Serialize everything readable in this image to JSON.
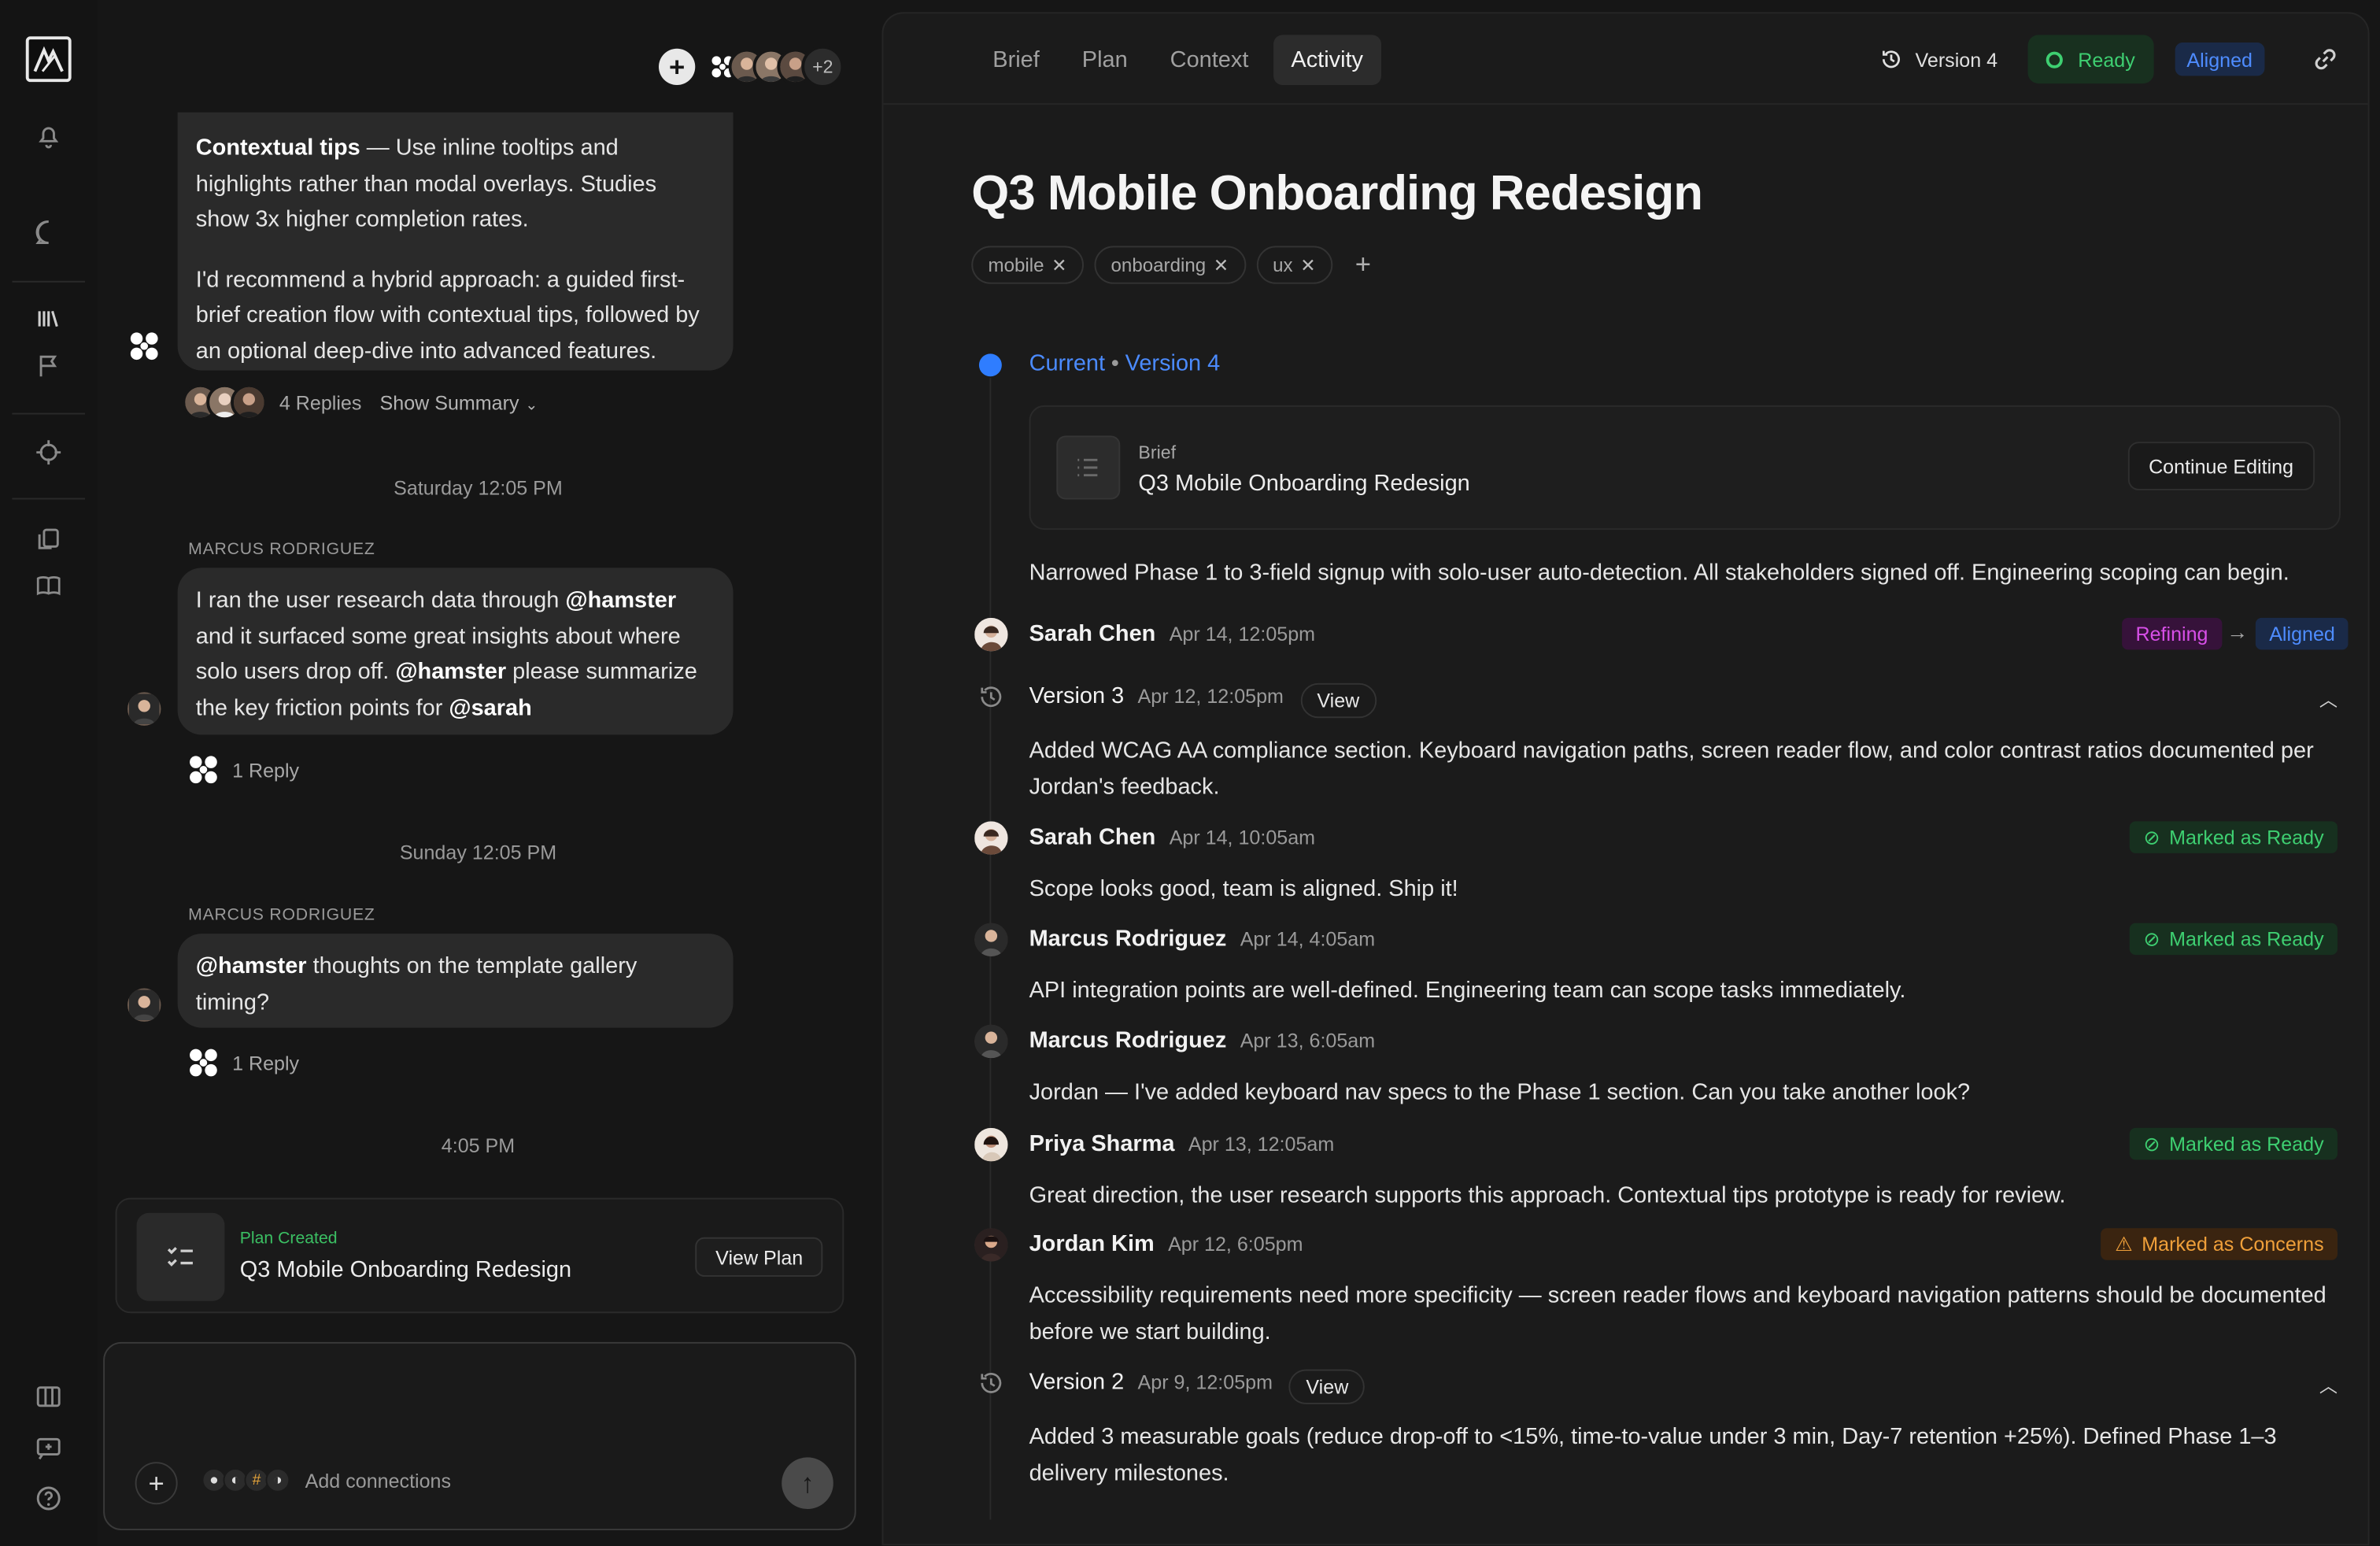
{
  "rail": {
    "items": [
      "bell-icon",
      "chat-icon",
      "library-icon",
      "flag-icon",
      "target-icon",
      "copy-icon",
      "book-icon",
      "columns-icon",
      "feedback-icon",
      "help-icon"
    ]
  },
  "chat": {
    "top": {
      "overflow_count": "+2"
    },
    "msg1": {
      "lead_bold": "Contextual tips",
      "lead_rest": " — Use inline tooltips and highlights rather than modal overlays. Studies show 3x higher completion rates.",
      "para2": "I'd recommend a hybrid approach: a guided first-brief creation flow with contextual tips, followed by an optional deep-dive into advanced features.",
      "replies": "4 Replies",
      "summary": "Show Summary"
    },
    "sep1": "Saturday 12:05 PM",
    "msg2": {
      "sender": "MARCUS RODRIGUEZ",
      "t1": "I ran the user research data through ",
      "m1": "@hamster",
      "t2": " and it surfaced some great insights about where solo users drop off. ",
      "m2": "@hamster",
      "t3": " please summarize the key friction points for ",
      "m3": "@sarah",
      "replies": "1 Reply"
    },
    "sep2": "Sunday 12:05 PM",
    "msg3": {
      "sender": "MARCUS RODRIGUEZ",
      "m1": "@hamster",
      "t1": " thoughts on the template gallery timing?",
      "replies": "1 Reply"
    },
    "sep3": "4:05 PM",
    "plan_card": {
      "kicker": "Plan Created",
      "title": "Q3 Mobile Onboarding Redesign",
      "button": "View Plan"
    },
    "composer": {
      "connections": "Add connections"
    }
  },
  "main": {
    "tabs": [
      {
        "label": "Brief"
      },
      {
        "label": "Plan"
      },
      {
        "label": "Context"
      },
      {
        "label": "Activity"
      }
    ],
    "version": "Version 4",
    "status_ready": "Ready",
    "status_aligned": "Aligned",
    "title": "Q3 Mobile Onboarding Redesign",
    "tags": [
      "mobile",
      "onboarding",
      "ux"
    ],
    "current": {
      "label": "Current",
      "version": "Version 4"
    },
    "brief_card": {
      "kicker": "Brief",
      "title": "Q3 Mobile Onboarding Redesign",
      "button": "Continue Editing"
    },
    "current_note": "Narrowed Phase 1 to 3-field signup with solo-user auto-detection. All stakeholders signed off. Engineering scoping can begin.",
    "entries": [
      {
        "name": "Sarah Chen",
        "date": "Apr 14, 12:05pm",
        "from": "Refining",
        "to": "Aligned"
      },
      {
        "name": "Version 3",
        "date": "Apr 12, 12:05pm",
        "view": "View",
        "text": "Added WCAG AA compliance section. Keyboard navigation paths, screen reader flow, and color contrast ratios documented per Jordan's feedback."
      },
      {
        "name": "Sarah Chen",
        "date": "Apr 14, 10:05am",
        "badge": "Marked as Ready",
        "text": "Scope looks good, team is aligned. Ship it!"
      },
      {
        "name": "Marcus Rodriguez",
        "date": "Apr 14, 4:05am",
        "badge": "Marked as Ready",
        "text": "API integration points are well-defined. Engineering team can scope tasks immediately."
      },
      {
        "name": "Marcus Rodriguez",
        "date": "Apr 13, 6:05am",
        "text": "Jordan — I've added keyboard nav specs to the Phase 1 section. Can you take another look?"
      },
      {
        "name": "Priya Sharma",
        "date": "Apr 13, 12:05am",
        "badge": "Marked as Ready",
        "text": "Great direction, the user research supports this approach. Contextual tips prototype is ready for review."
      },
      {
        "name": "Jordan Kim",
        "date": "Apr 12, 6:05pm",
        "badge": "Marked as Concerns",
        "text": "Accessibility requirements need more specificity — screen reader flows and keyboard navigation patterns should be documented before we start building."
      },
      {
        "name": "Version 2",
        "date": "Apr 9, 12:05pm",
        "view": "View",
        "text": "Added 3 measurable goals (reduce drop-off to <15%, time-to-value under 3 min, Day-7 retention +25%). Defined Phase 1–3 delivery milestones."
      }
    ]
  },
  "colors": {
    "accent": "#2f7dff",
    "ready": "#3ecf71",
    "concern": "#f0a03a",
    "refining": "#d84fe8"
  }
}
